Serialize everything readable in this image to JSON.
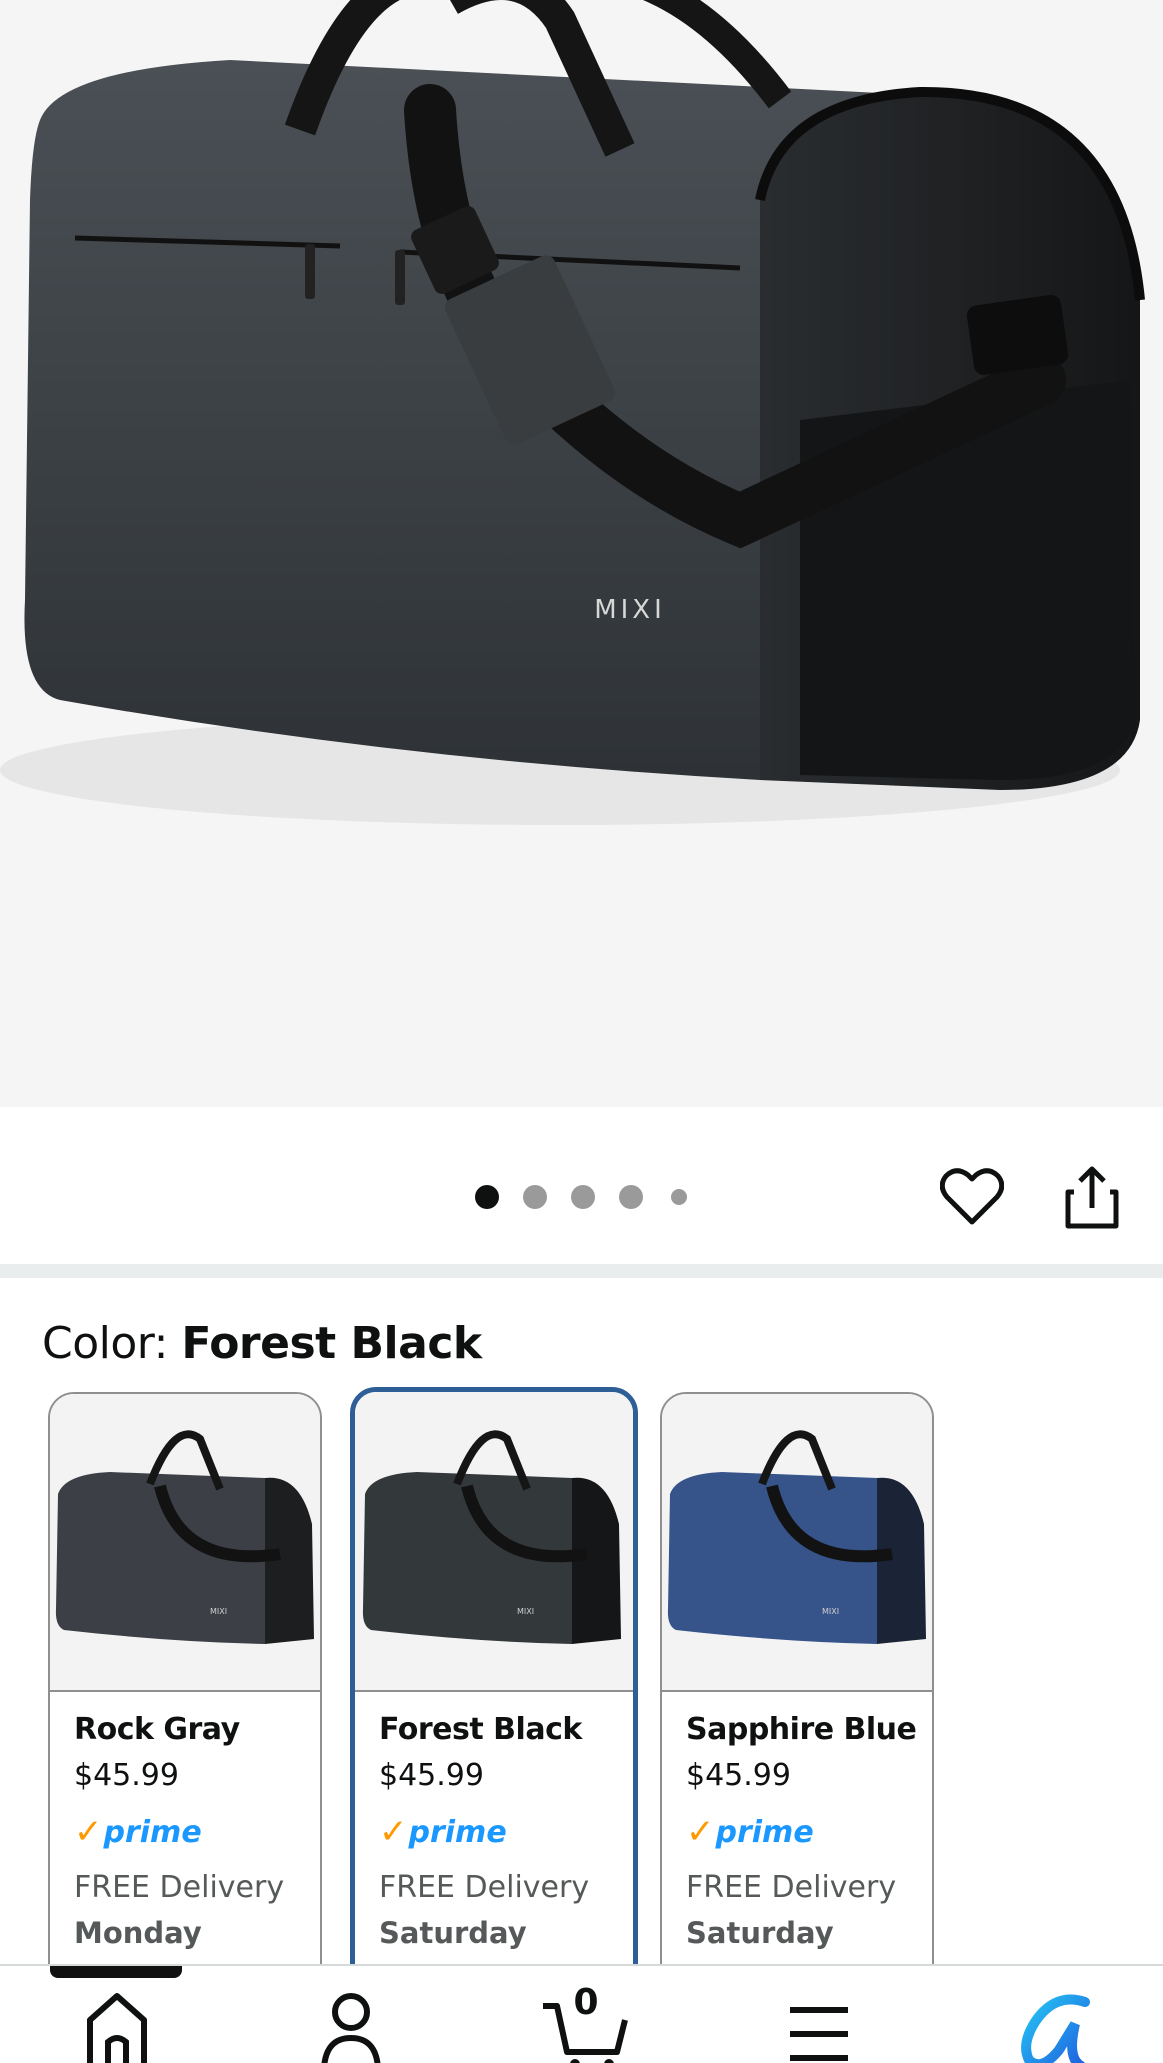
{
  "hero": {
    "brand_mark": "MIXI",
    "carousel_count": 5,
    "active_index": 0
  },
  "actions": {
    "favorite_icon": "heart-icon",
    "share_icon": "share-icon"
  },
  "color_selector": {
    "label": "Color: ",
    "selected": "Forest Black",
    "options": [
      {
        "name": "Rock Gray",
        "price": "$45.99",
        "prime": "prime",
        "delivery": "FREE Delivery",
        "day": "Monday",
        "color": "#3c4046"
      },
      {
        "name": "Forest Black",
        "price": "$45.99",
        "prime": "prime",
        "delivery": "FREE Delivery",
        "day": "Saturday",
        "color": "#33383b"
      },
      {
        "name": "Sapphire Blue",
        "price": "$45.99",
        "prime": "prime",
        "delivery": "FREE Delivery",
        "day": "Saturday",
        "color": "#36548a"
      }
    ]
  },
  "nav": {
    "items": [
      "home-icon",
      "account-icon",
      "cart-icon",
      "menu-icon",
      "rufus-icon"
    ],
    "cart_count": "0"
  },
  "colors": {
    "accent_selected": "#2d5f96",
    "prime_blue": "#1a98ff",
    "prime_check": "#ff9900"
  }
}
